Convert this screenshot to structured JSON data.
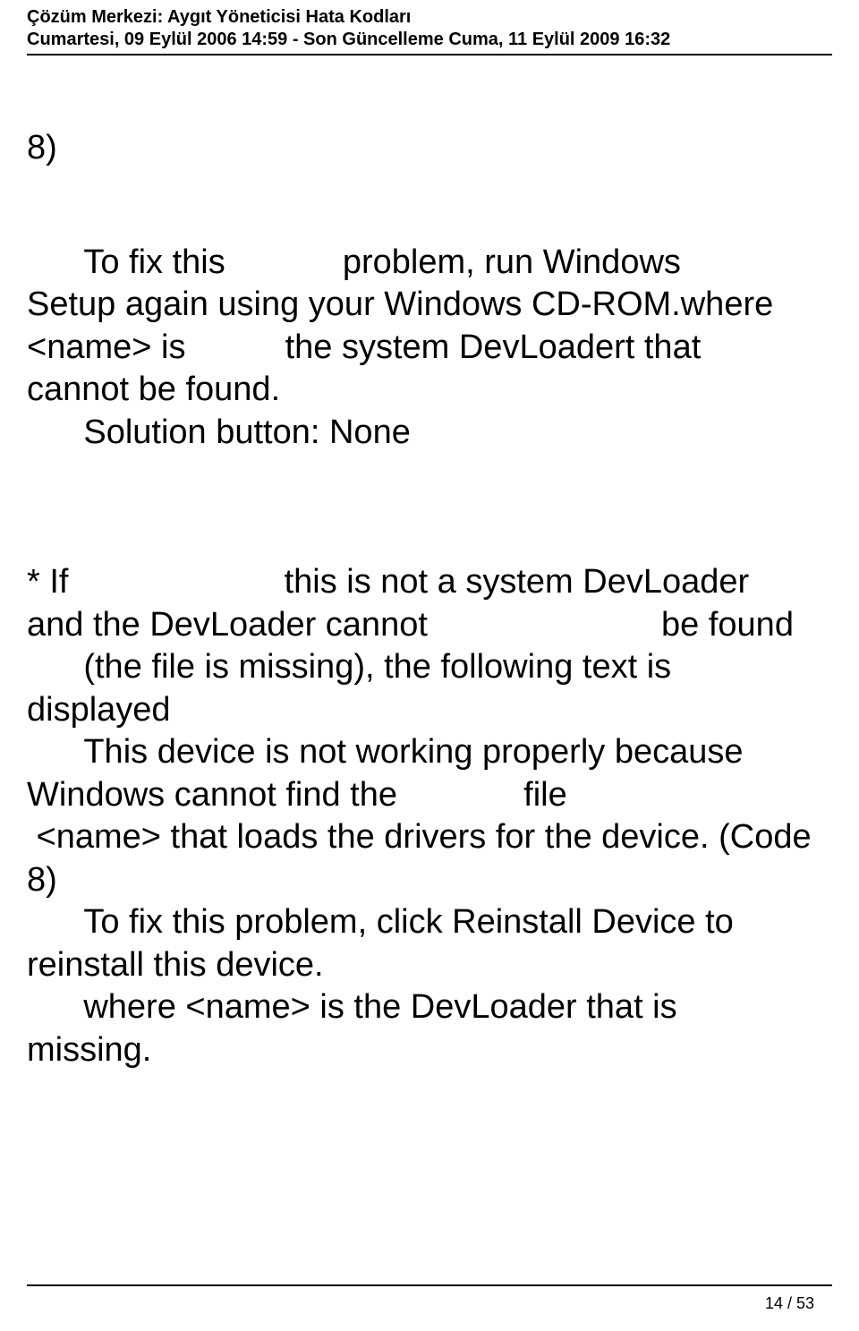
{
  "header": {
    "title": "Çözüm Merkezi: Aygıt Yöneticisi Hata Kodları",
    "meta": "Cumartesi, 09 Eylül 2006 14:59 - Son Güncelleme Cuma, 11 Eylül 2009 16:32"
  },
  "body": {
    "l1": "8)",
    "l2a": "      To fix this",
    "l2b": "problem, run Windows",
    "l3": "Setup again using your Windows CD-ROM.where",
    "l4a": "<name> is",
    "l4b": "the system DevLoadert that",
    "l5": "cannot be found.",
    "l6": "      Solution button: None",
    "l7a": "* If",
    "l7b": "this is not a system DevLoader",
    "l8a": "and the DevLoader cannot",
    "l8b": "be found",
    "l9": "      (the file is missing), the following text is",
    "l10": "displayed",
    "l11": "      This device is not working properly because",
    "l12a": "Windows cannot find the",
    "l12b": "file",
    "l13": " <name> that loads the drivers for the device. (Code",
    "l14": "8)",
    "l15": "      To fix this problem, click Reinstall Device to",
    "l16": "reinstall this device.",
    "l17": "      where <name> is the DevLoader that is",
    "l18": "missing."
  },
  "footer": {
    "page": "14 / 53"
  }
}
